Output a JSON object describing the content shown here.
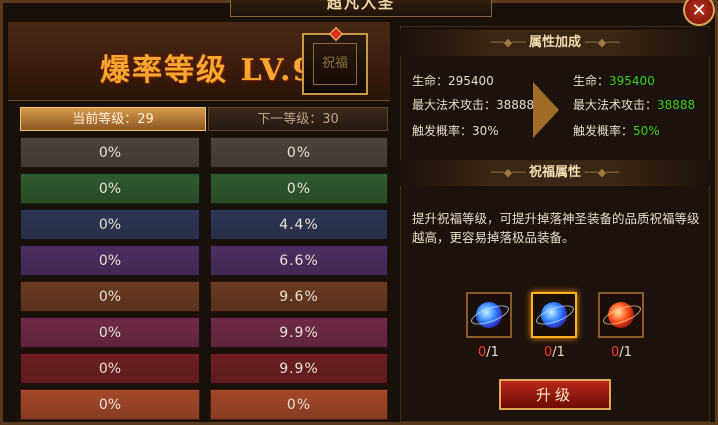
{
  "window": {
    "title": "超凡入圣",
    "close_icon": "close-icon"
  },
  "header": {
    "level_text": "爆率等级 LV.9",
    "emblem_text": "祝福"
  },
  "tabs": {
    "current": "当前等级：29",
    "next": "下一等级：30"
  },
  "rows": [
    {
      "current": "0%",
      "next": "0%",
      "color": "#4a443c"
    },
    {
      "current": "0%",
      "next": "0%",
      "color": "#2f5a30"
    },
    {
      "current": "0%",
      "next": "4.4%",
      "color": "#2c3656"
    },
    {
      "current": "0%",
      "next": "6.6%",
      "color": "#4b2f63"
    },
    {
      "current": "0%",
      "next": "9.6%",
      "color": "#6a3a22"
    },
    {
      "current": "0%",
      "next": "9.9%",
      "color": "#6e2a48"
    },
    {
      "current": "0%",
      "next": "9.9%",
      "color": "#6e1f24"
    },
    {
      "current": "0%",
      "next": "0%",
      "color": "#a4482a"
    }
  ],
  "attributes": {
    "heading": "属性加成",
    "current": {
      "hp": "生命：295400",
      "atk": "最大法术攻击：38888",
      "rate": "触发概率：30%"
    },
    "next": {
      "hp_label": "生命：",
      "hp_value": "395400",
      "atk_label": "最大法术攻击：",
      "atk_value": "38888",
      "rate_label": "触发概率：",
      "rate_value": "50%"
    }
  },
  "blessing": {
    "heading": "祝福属性",
    "description": "提升祝福等级，可提升掉落神圣装备的品质祝福等级越高，更容易掉落极品装备。",
    "items": [
      {
        "icon": "blue-orb-icon",
        "have": "0",
        "need": "/1"
      },
      {
        "icon": "blue-orb-icon",
        "have": "0",
        "need": "/1"
      },
      {
        "icon": "red-orb-icon",
        "have": "0",
        "need": "/1"
      }
    ]
  },
  "upgrade_button": "升级"
}
